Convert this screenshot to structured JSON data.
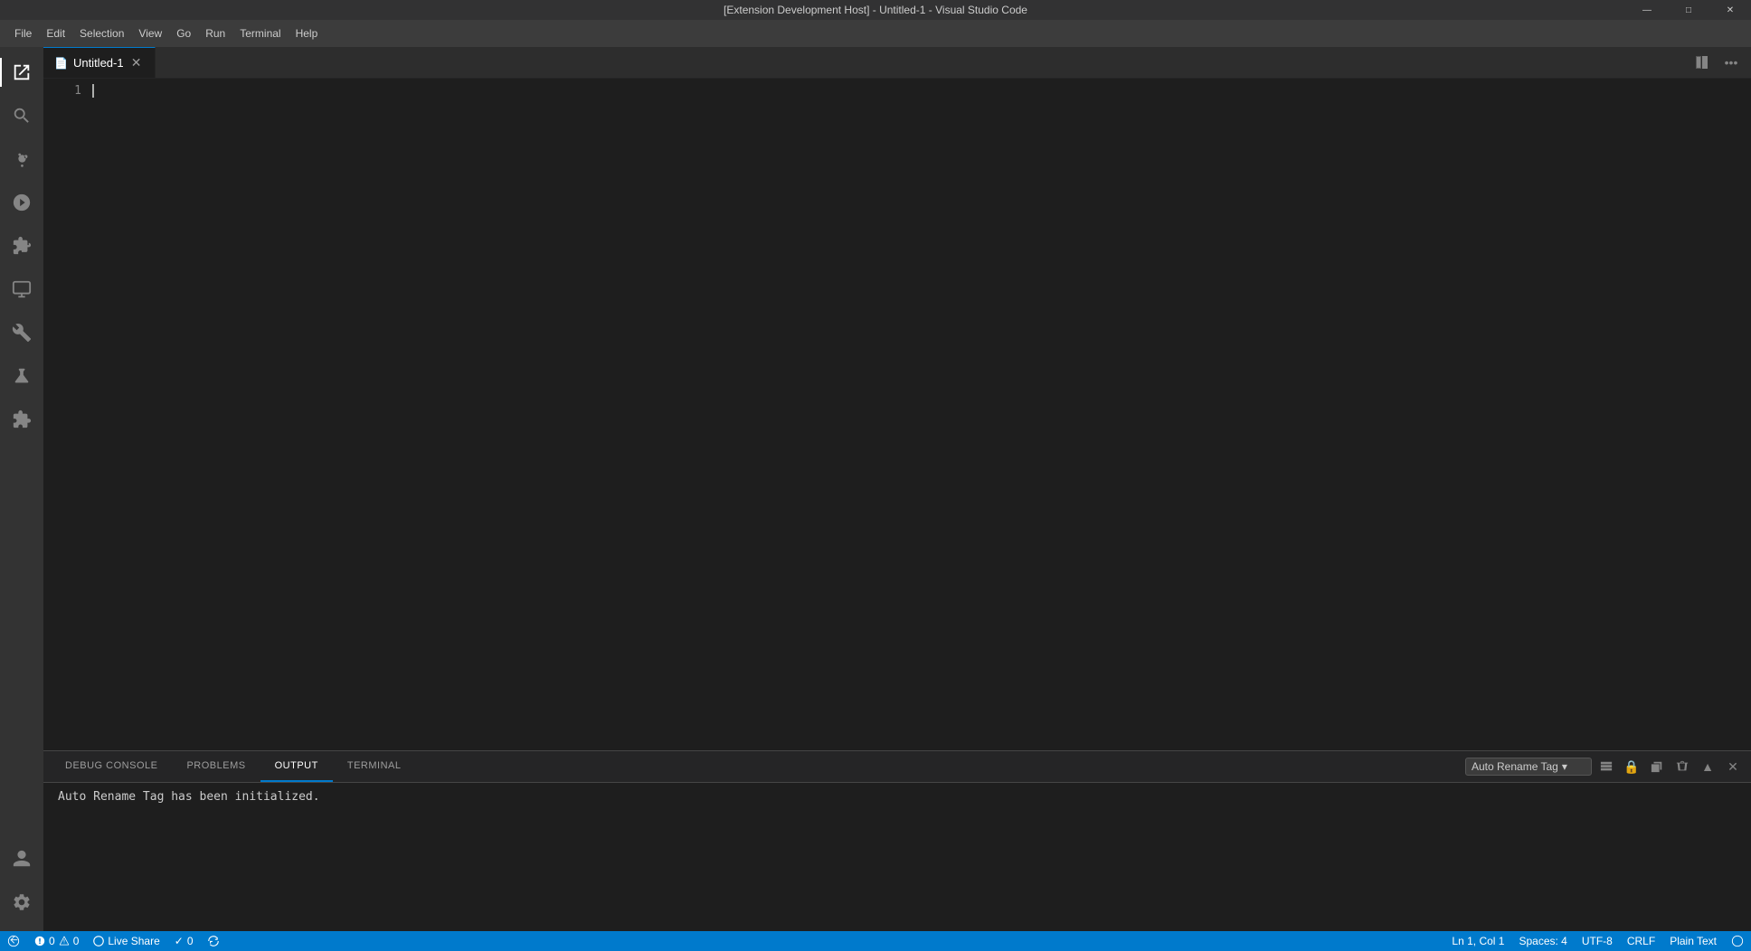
{
  "titlebar": {
    "title": "[Extension Development Host] - Untitled-1 - Visual Studio Code",
    "minimize": "🗕",
    "maximize": "🗗",
    "close": "✕"
  },
  "menubar": {
    "items": [
      "File",
      "Edit",
      "Selection",
      "View",
      "Go",
      "Run",
      "Terminal",
      "Help"
    ]
  },
  "activitybar": {
    "icons": [
      {
        "name": "explorer-icon",
        "symbol": "⬜",
        "label": "Explorer",
        "active": true
      },
      {
        "name": "search-icon",
        "symbol": "🔍",
        "label": "Search"
      },
      {
        "name": "source-control-icon",
        "symbol": "⎇",
        "label": "Source Control"
      },
      {
        "name": "run-debug-icon",
        "symbol": "▷",
        "label": "Run and Debug"
      },
      {
        "name": "extensions-icon",
        "symbol": "⊞",
        "label": "Extensions"
      },
      {
        "name": "remote-explorer-icon",
        "symbol": "⊡",
        "label": "Remote Explorer"
      },
      {
        "name": "extension-dev-icon",
        "symbol": "🔧",
        "label": "Extension Development"
      },
      {
        "name": "flask-icon",
        "symbol": "⚗",
        "label": "Testing"
      },
      {
        "name": "puzzle-icon",
        "symbol": "⊟",
        "label": "Puzzle"
      }
    ],
    "bottom": [
      {
        "name": "accounts-icon",
        "symbol": "◉",
        "label": "Accounts"
      },
      {
        "name": "settings-icon",
        "symbol": "⚙",
        "label": "Manage"
      }
    ]
  },
  "tabs": [
    {
      "label": "Untitled-1",
      "active": true,
      "dirty": false
    }
  ],
  "editor": {
    "line_numbers": [
      "1"
    ],
    "content": ""
  },
  "panel": {
    "tabs": [
      "DEBUG CONSOLE",
      "PROBLEMS",
      "OUTPUT",
      "TERMINAL"
    ],
    "active_tab": "OUTPUT",
    "dropdown_label": "Auto Rename Tag",
    "content": "Auto Rename Tag has been initialized."
  },
  "statusbar": {
    "left_items": [
      {
        "name": "remote-status",
        "icon": "⊞",
        "text": ""
      },
      {
        "name": "error-count",
        "icon": "✗",
        "text": "0"
      },
      {
        "name": "warning-count",
        "icon": "⚠",
        "text": "0"
      },
      {
        "name": "live-share",
        "icon": "◎",
        "text": "Live Share"
      },
      {
        "name": "check-icon",
        "icon": "✓",
        "text": "0"
      },
      {
        "name": "sync-icon",
        "icon": "↻",
        "text": ""
      }
    ],
    "right_items": [
      {
        "name": "line-col",
        "text": "Ln 1, Col 1"
      },
      {
        "name": "spaces",
        "text": "Spaces: 4"
      },
      {
        "name": "encoding",
        "text": "UTF-8"
      },
      {
        "name": "line-ending",
        "text": "CRLF"
      },
      {
        "name": "language",
        "text": "Plain Text"
      },
      {
        "name": "notifications",
        "icon": "🔔",
        "text": ""
      }
    ]
  }
}
